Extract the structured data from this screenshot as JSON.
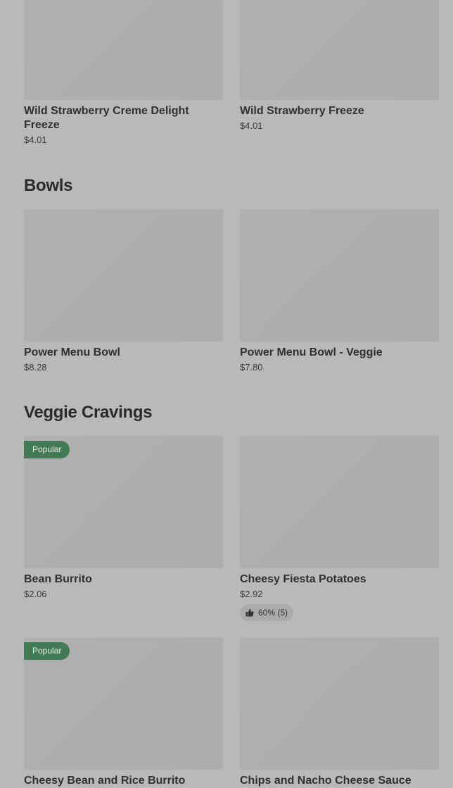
{
  "sections": [
    {
      "title": "",
      "items": [
        {
          "name": "Wild Strawberry Creme Delight Freeze",
          "price": "$4.01"
        },
        {
          "name": "Wild Strawberry Freeze",
          "price": "$4.01"
        }
      ]
    },
    {
      "title": "Bowls",
      "items": [
        {
          "name": "Power Menu Bowl",
          "price": "$8.28"
        },
        {
          "name": "Power Menu Bowl - Veggie",
          "price": "$7.80"
        }
      ]
    },
    {
      "title": "Veggie Cravings",
      "items": [
        {
          "name": "Bean Burrito",
          "price": "$2.06",
          "badge": "Popular"
        },
        {
          "name": "Cheesy Fiesta Potatoes",
          "price": "$2.92",
          "rating": "60% (5)"
        },
        {
          "name": "Cheesy Bean and Rice Burrito",
          "badge": "Popular"
        },
        {
          "name": "Chips and Nacho Cheese Sauce"
        }
      ]
    }
  ],
  "icons": {
    "rating_icon": "thumbs-up-icon"
  },
  "colors": {
    "background": "#b9b9b9",
    "badge": "#437a56"
  }
}
